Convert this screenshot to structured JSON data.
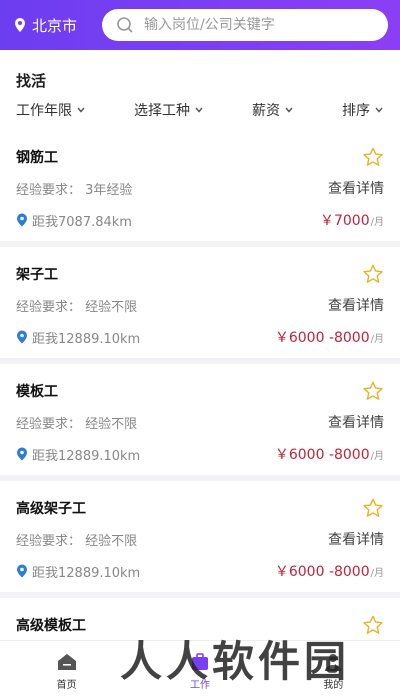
{
  "topbar": {
    "city": "北京市",
    "search_placeholder": "输入岗位/公司关键字"
  },
  "header": {
    "title": "找活",
    "filters": [
      "工作年限",
      "选择工种",
      "薪资",
      "排序"
    ]
  },
  "jobs": [
    {
      "title": "钢筋工",
      "experience": "经验要求：  3年经验",
      "details": "查看详情",
      "distance": "距我7087.84km",
      "salary": "￥7000",
      "unit": "/月"
    },
    {
      "title": "架子工",
      "experience": "经验要求：  经验不限",
      "details": "查看详情",
      "distance": "距我12889.10km",
      "salary": "￥6000 -8000",
      "unit": "/月"
    },
    {
      "title": "模板工",
      "experience": "经验要求：  经验不限",
      "details": "查看详情",
      "distance": "距我12889.10km",
      "salary": "￥6000 -8000",
      "unit": "/月"
    },
    {
      "title": "高级架子工",
      "experience": "经验要求：  经验不限",
      "details": "查看详情",
      "distance": "距我12889.10km",
      "salary": "￥6000 -8000",
      "unit": "/月"
    },
    {
      "title": "高级模板工",
      "experience": "",
      "details": "",
      "distance": "",
      "salary": "",
      "unit": ""
    }
  ],
  "tabbar": {
    "home": "首页",
    "work": "工作",
    "mine": "我的"
  },
  "watermark": "人人软件园",
  "colors": {
    "brand": "#7a3ef2",
    "salary": "#c0243b",
    "star": "#e6b422",
    "location": "#2a7fd4"
  }
}
